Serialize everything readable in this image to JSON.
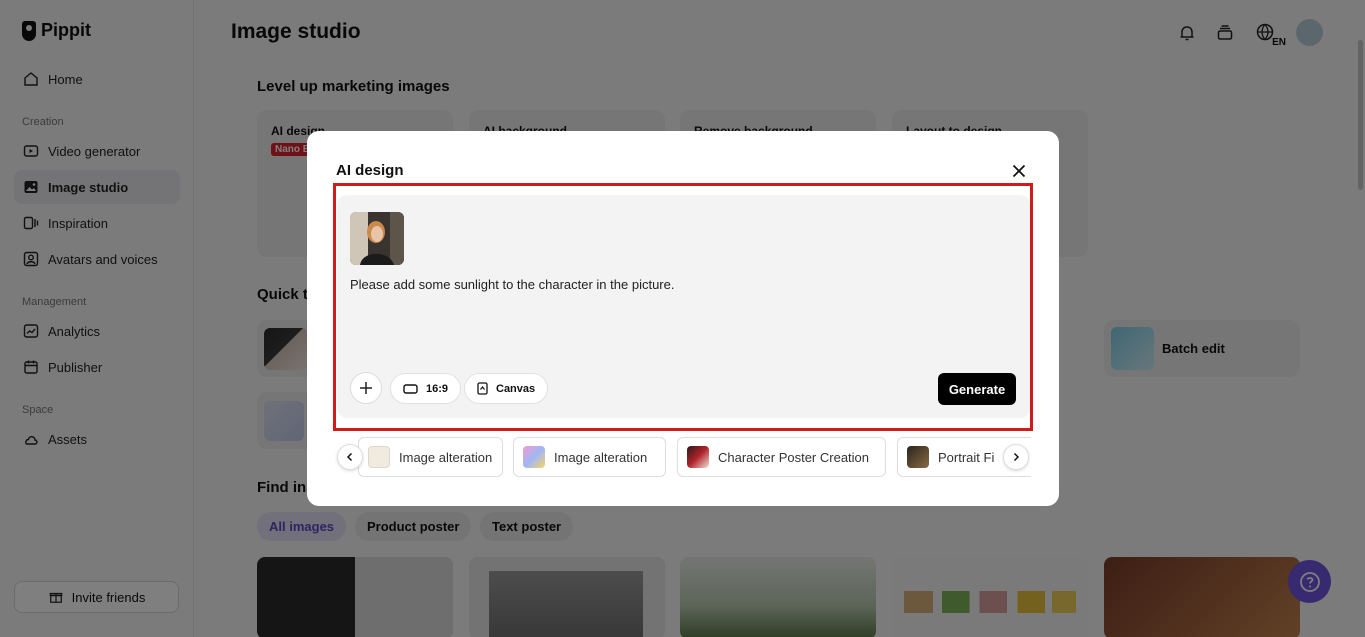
{
  "app": {
    "name": "Pippit"
  },
  "sidebar": {
    "items": [
      {
        "label": "Home",
        "icon": "home-icon"
      },
      {
        "label": "Video generator",
        "icon": "video-icon"
      },
      {
        "label": "Image studio",
        "icon": "image-icon"
      },
      {
        "label": "Inspiration",
        "icon": "inspiration-icon"
      },
      {
        "label": "Avatars and voices",
        "icon": "avatar-icon"
      },
      {
        "label": "Analytics",
        "icon": "analytics-icon"
      },
      {
        "label": "Publisher",
        "icon": "calendar-icon"
      },
      {
        "label": "Assets",
        "icon": "cloud-icon"
      }
    ],
    "sections": {
      "creation": "Creation",
      "management": "Management",
      "space": "Space"
    },
    "invite_label": "Invite friends"
  },
  "header": {
    "title": "Image studio",
    "language": "EN"
  },
  "main": {
    "section_marketing": "Level up marketing images",
    "cards": [
      {
        "label": "AI design",
        "badge": "Nano B"
      },
      {
        "label": "AI background"
      },
      {
        "label": "Remove background"
      },
      {
        "label": "Layout to design"
      }
    ],
    "section_quick": "Quick t",
    "batch_edit": "Batch edit",
    "section_find": "Find ins",
    "filters": [
      "All images",
      "Product poster",
      "Text poster"
    ]
  },
  "modal": {
    "title": "AI design",
    "prompt": "Please add some sunlight to the character in the picture.",
    "aspect_ratio": "16:9",
    "canvas_label": "Canvas",
    "generate_label": "Generate",
    "suggestions": [
      "Image alteration",
      "Image alteration",
      "Character Poster Creation",
      "Portrait Fi"
    ]
  },
  "colors": {
    "accent": "#6f54e0",
    "highlight": "#d11a1a",
    "badge": "#e0202e"
  }
}
